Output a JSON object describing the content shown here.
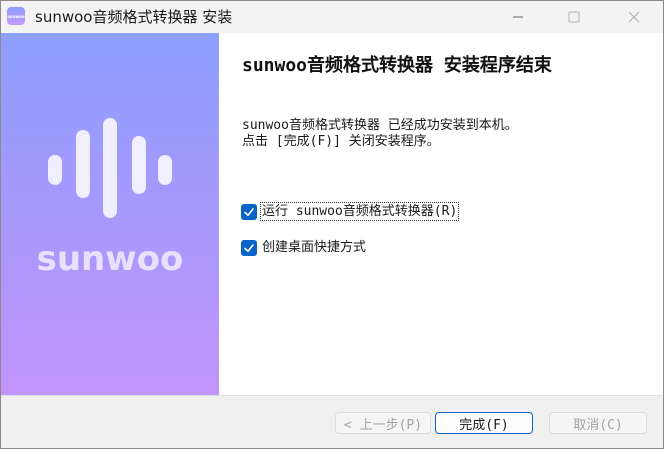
{
  "window": {
    "title": "sunwoo音频格式转换器 安装",
    "app_icon_text": "sunwoo"
  },
  "banner": {
    "brand_text": "sunwoo"
  },
  "content": {
    "heading": "sunwoo音频格式转换器 安装程序结束",
    "message_line1": "sunwoo音频格式转换器 已经成功安装到本机。",
    "message_line2": "点击 [完成(F)] 关闭安装程序。",
    "checkbox_run": {
      "label": "运行 sunwoo音频格式转换器(R)",
      "checked": true
    },
    "checkbox_shortcut": {
      "label": "创建桌面快捷方式",
      "checked": true
    }
  },
  "buttons": {
    "back": "< 上一步(P)",
    "finish": "完成(F)",
    "cancel": "取消(C)"
  },
  "colors": {
    "accent": "#0a64c8",
    "banner_top": "#8d9ffd",
    "banner_bottom": "#c294fa"
  }
}
